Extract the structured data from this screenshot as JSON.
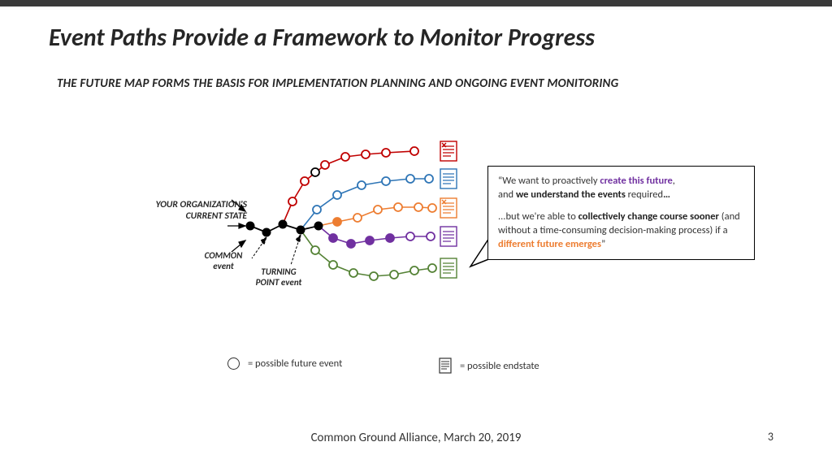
{
  "title": "Event Paths Provide a Framework to Monitor Progress",
  "subtitle": "THE FUTURE MAP FORMS THE BASIS FOR IMPLEMENTATION PLANNING AND ONGOING EVENT MONITORING",
  "labels": {
    "current_state_l1": "YOUR ORGANIZATION'S",
    "current_state_l2": "CURRENT STATE",
    "common_l1": "COMMON",
    "common_l2": "event",
    "turning_l1": "TURNING",
    "turning_l2": "POINT event"
  },
  "callout": {
    "l1a": "“We want to proactively ",
    "l1b": "create this future",
    "l1c": ",",
    "l2a": "and ",
    "l2b": "we understand the events",
    "l2c": " required",
    "l2d": "…",
    "l3a": "...but we're able to ",
    "l3b": "collectively change course sooner",
    "l3c": " (and without a time-consuming decision-making process) if a ",
    "l3d": "different future emerges",
    "l3e": "”"
  },
  "legend": {
    "event": "= possible future event",
    "endstate": "= possible endstate"
  },
  "footer": "Common Ground Alliance, March 20, 2019",
  "page": "3",
  "colors": {
    "red": "#c00000",
    "blue": "#2e75b6",
    "orange": "#ed7d31",
    "purple": "#7030a0",
    "green": "#548235",
    "black": "#000000"
  }
}
